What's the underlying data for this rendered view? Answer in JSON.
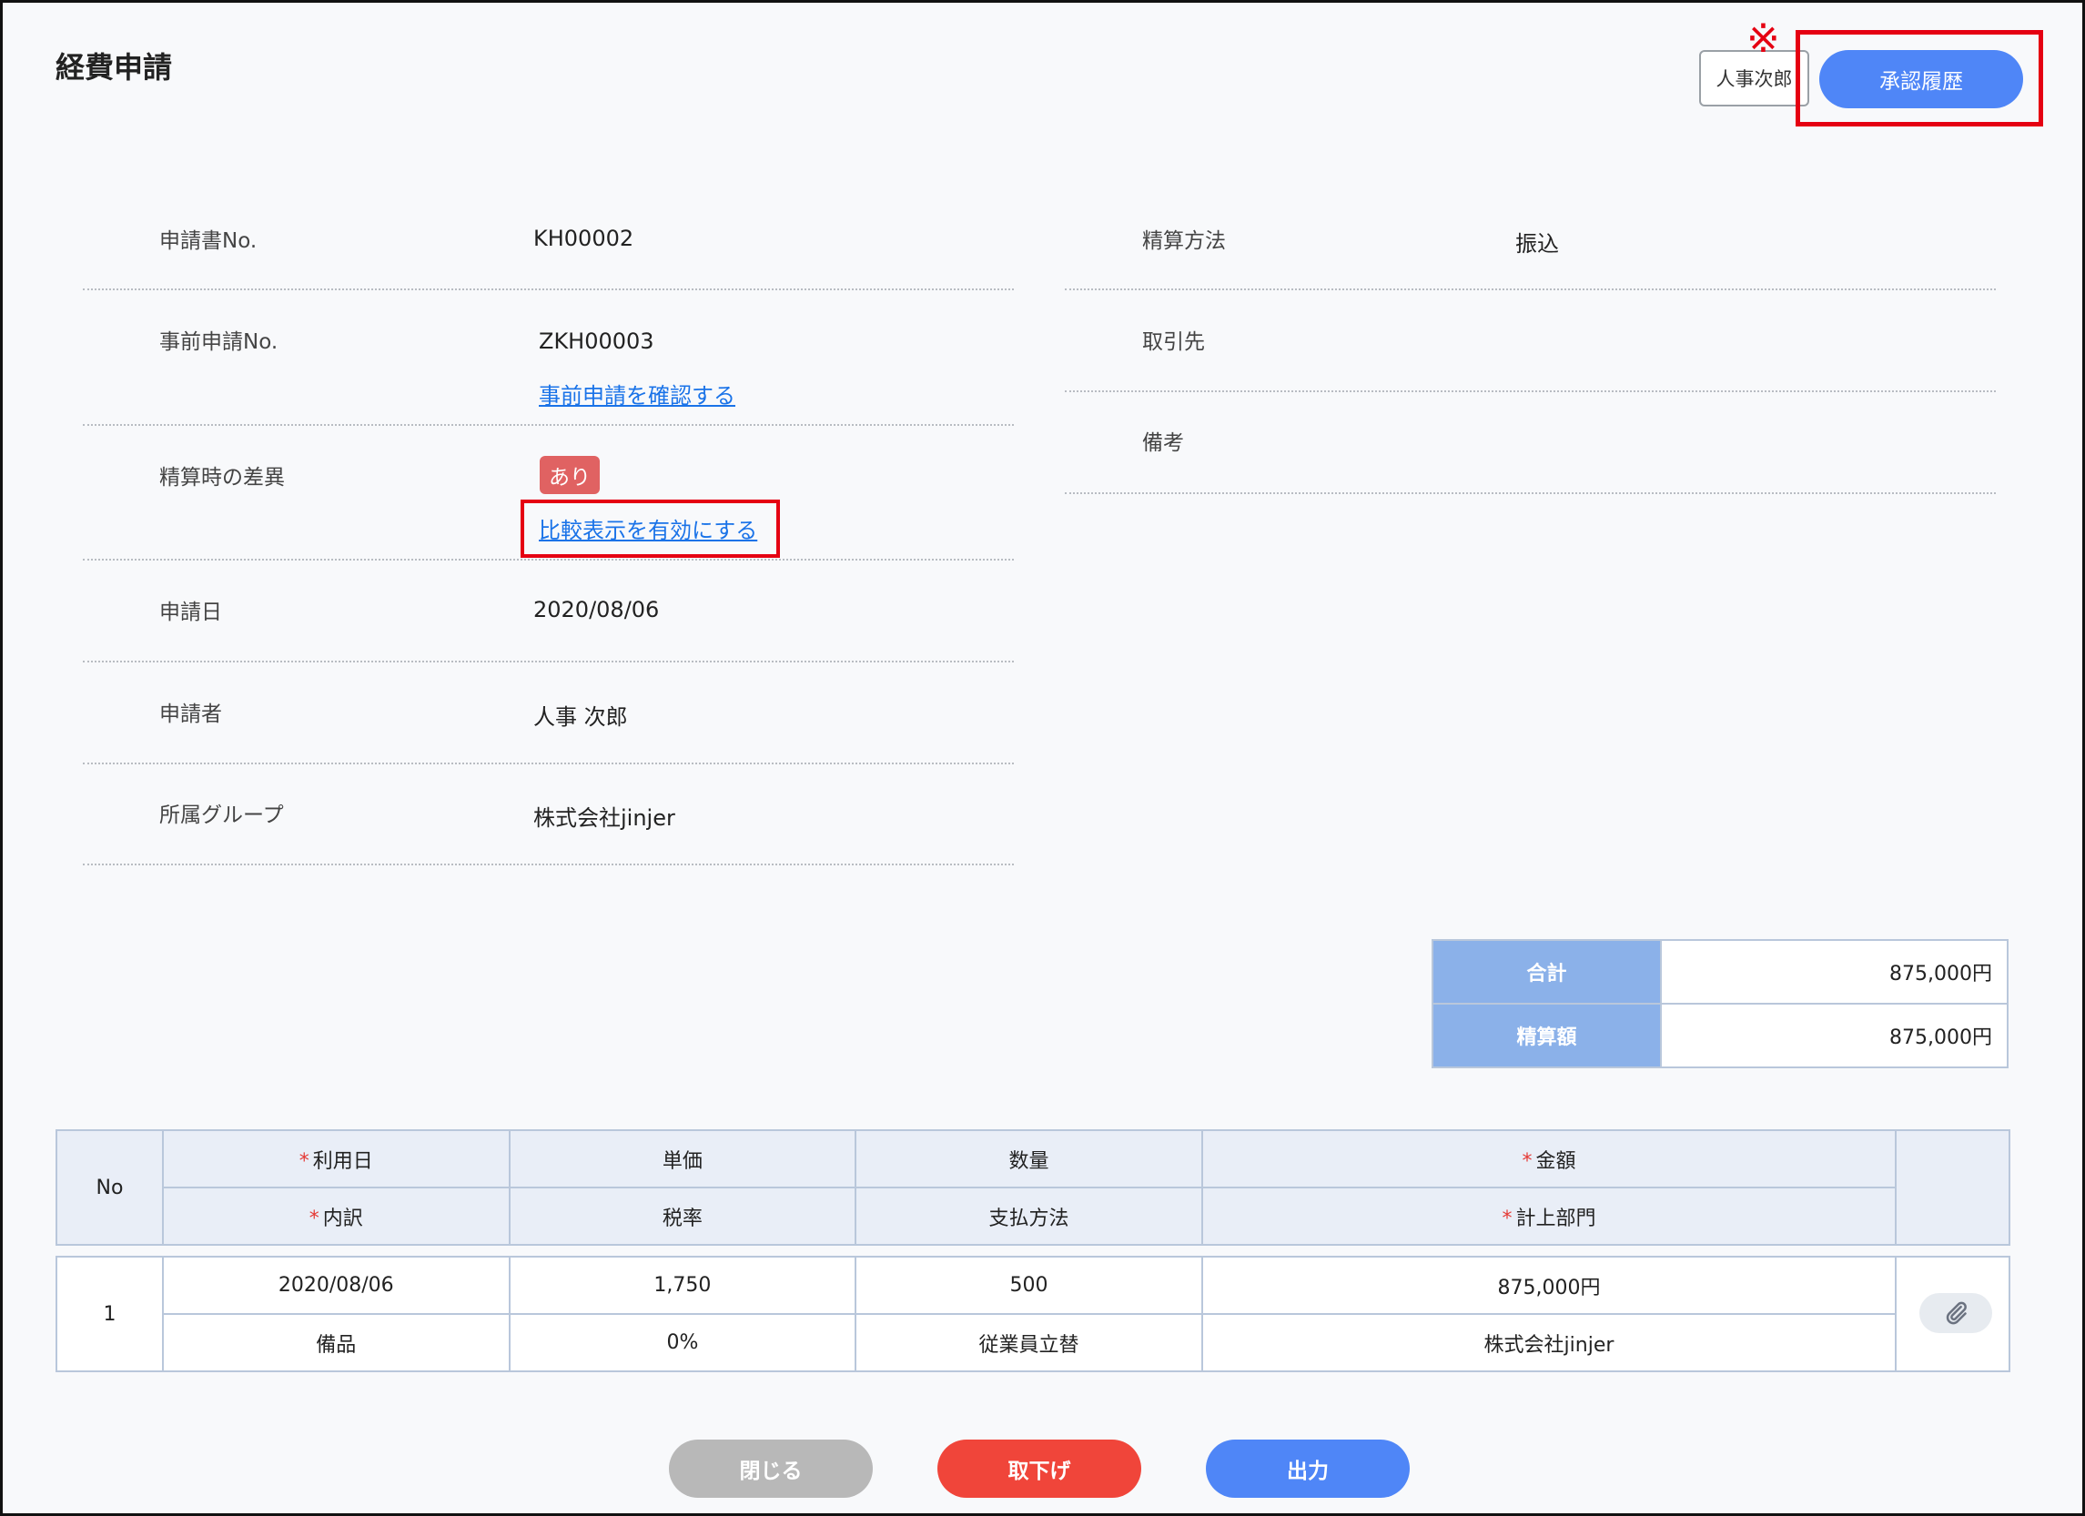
{
  "page": {
    "title": "経費申請"
  },
  "header": {
    "annotation_mark": "※",
    "user_label": "人事次郎",
    "history_label": "承認履歴"
  },
  "left_fields": [
    {
      "label": "申請書No.",
      "value": "KH00002"
    },
    {
      "label": "事前申請No.",
      "value": "ZKH00003",
      "link": "事前申請を確認する"
    },
    {
      "label": "精算時の差異",
      "badge": "あり",
      "link": "比較表示を有効にする"
    },
    {
      "label": "申請日",
      "value": "2020/08/06"
    },
    {
      "label": "申請者",
      "value": "人事 次郎"
    },
    {
      "label": "所属グループ",
      "value": "株式会社jinjer"
    }
  ],
  "right_fields": [
    {
      "label": "精算方法",
      "value": "振込"
    },
    {
      "label": "取引先",
      "value": ""
    },
    {
      "label": "備考",
      "value": ""
    }
  ],
  "summary": {
    "total_label": "合計",
    "total_value": "875,000円",
    "settle_label": "精算額",
    "settle_value": "875,000円"
  },
  "detail_table": {
    "headers": {
      "no": "No",
      "top": [
        "利用日",
        "単価",
        "数量",
        "金額"
      ],
      "bottom": [
        "内訳",
        "税率",
        "支払方法",
        "計上部門"
      ],
      "required_mark": "*"
    },
    "rows": [
      {
        "no": "1",
        "top": [
          "2020/08/06",
          "1,750",
          "500",
          "875,000円"
        ],
        "bottom": [
          "備品",
          "0%",
          "従業員立替",
          "株式会社jinjer"
        ],
        "attachment_icon": "paperclip-icon"
      }
    ]
  },
  "footer": {
    "close_label": "閉じる",
    "withdraw_label": "取下げ",
    "output_label": "出力"
  },
  "colors": {
    "primary": "#4f86f7",
    "danger": "#f0453a",
    "disabled": "#b8b8b8",
    "highlight": "#e50012",
    "badge": "#e06262",
    "table_header": "#8bb1e9"
  }
}
